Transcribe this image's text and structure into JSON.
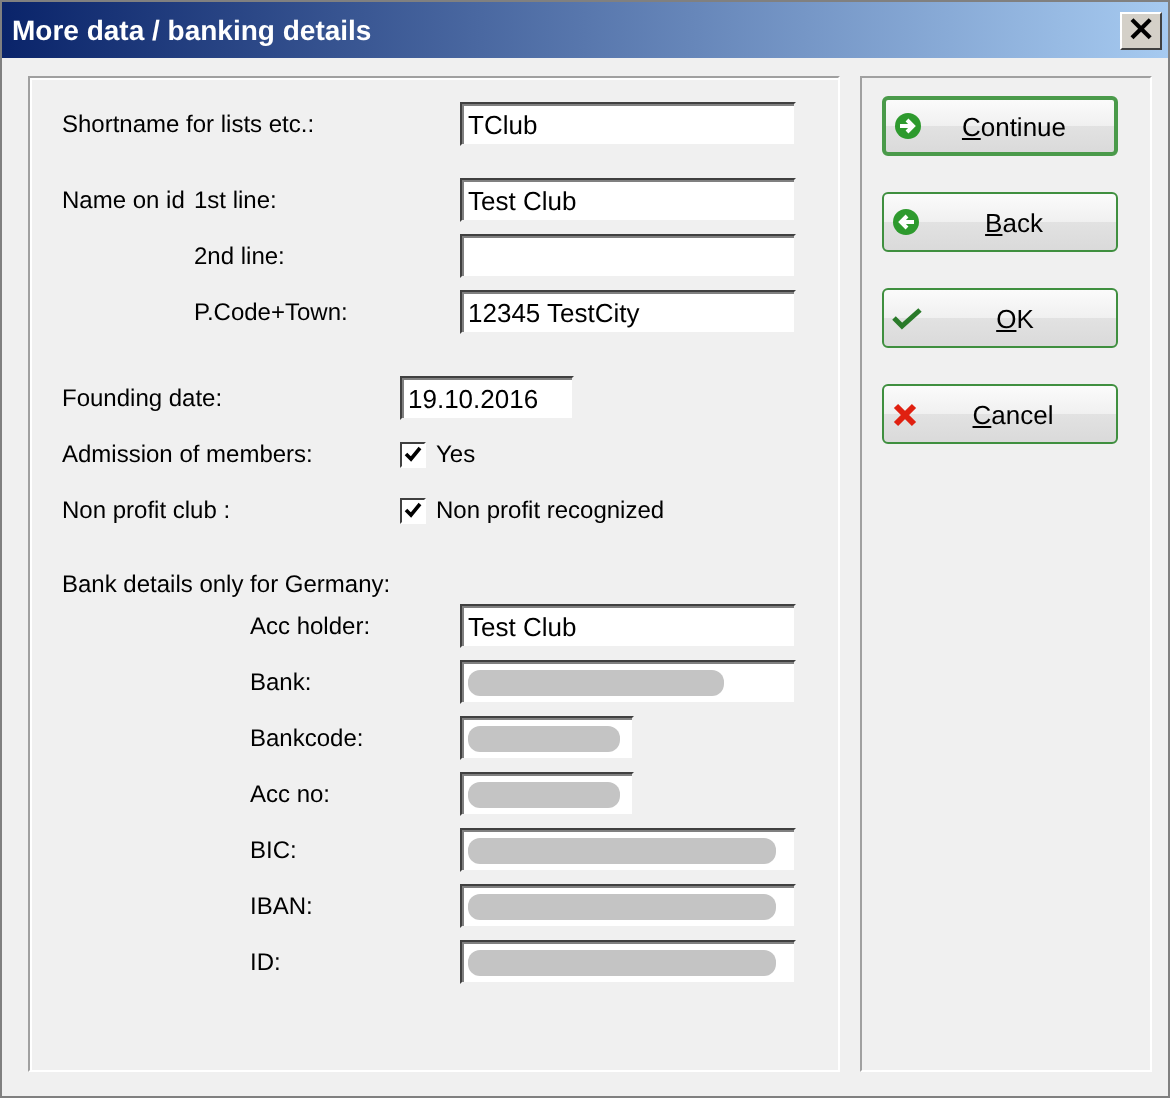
{
  "window": {
    "title": "More data / banking details",
    "close": "×"
  },
  "shortname": {
    "label": "Shortname for lists etc.:",
    "value": "TClub"
  },
  "name_on_id": {
    "label": "Name on id",
    "lines": [
      {
        "label": "1st line:",
        "value": "Test Club"
      },
      {
        "label": "2nd line:"
      },
      {
        "label": "P.Code+Town:",
        "value": "12345 TestCity"
      }
    ]
  },
  "founding_date": {
    "label": "Founding date:",
    "value": "19.10.2016"
  },
  "options": [
    {
      "label": "Admission of members:",
      "checkbox_label": "Yes",
      "checked": true
    },
    {
      "label": "Non profit club :",
      "checkbox_label": "Non profit recognized",
      "checked": true
    }
  ],
  "bank": {
    "heading": "Bank details only for Germany:",
    "fields": [
      {
        "label": "Acc holder:",
        "value": "Test Club",
        "redacted": false
      },
      {
        "label": "Bank:",
        "redacted": true
      },
      {
        "label": "Bankcode:",
        "redacted": true
      },
      {
        "label": "Acc no:",
        "redacted": true
      },
      {
        "label": "BIC:",
        "redacted": true
      },
      {
        "label": "IBAN:",
        "redacted": true
      },
      {
        "label": "ID:",
        "redacted": true
      }
    ]
  },
  "buttons": [
    {
      "label": "Continue",
      "kind": "forward",
      "default": true
    },
    {
      "label": "Back",
      "kind": "back",
      "default": false
    },
    {
      "label": "OK",
      "kind": "confirm",
      "default": false
    },
    {
      "label": "Cancel",
      "kind": "cancel",
      "default": false
    }
  ]
}
